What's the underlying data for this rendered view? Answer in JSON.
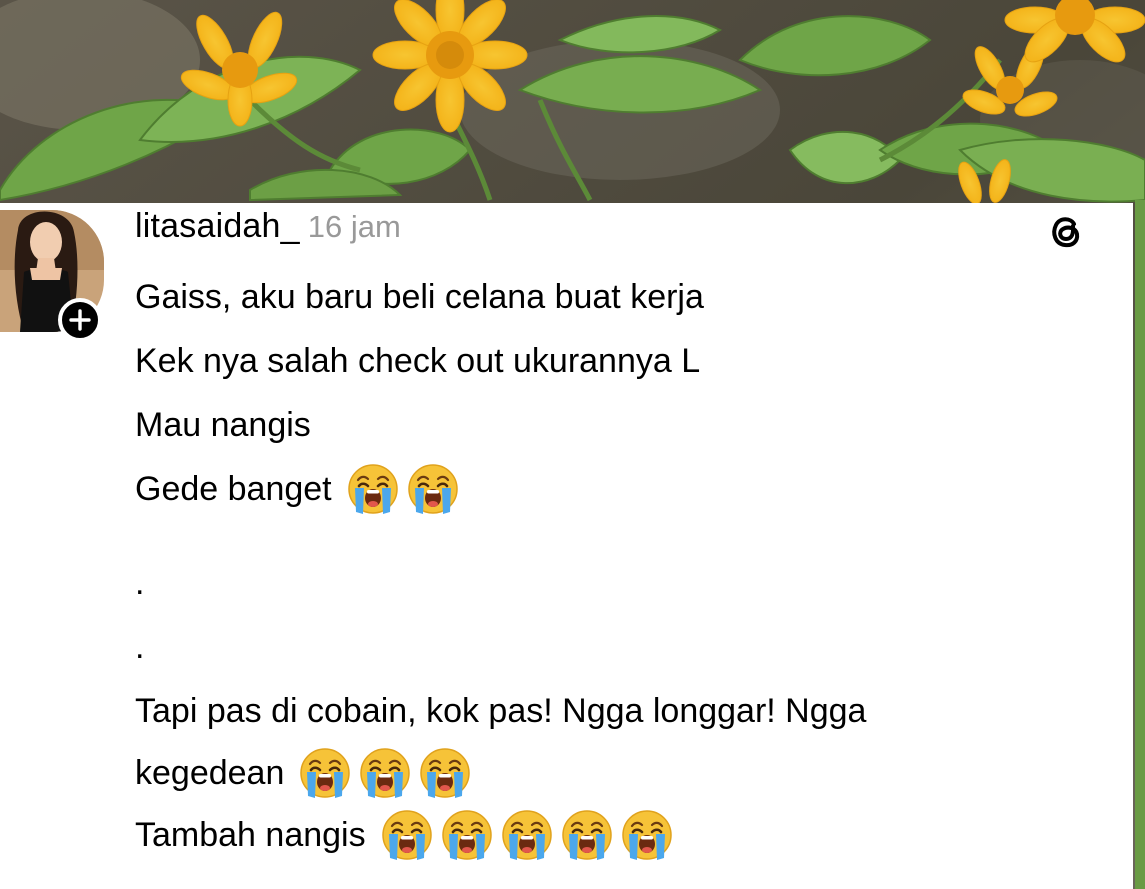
{
  "post": {
    "username": "litasaidah_",
    "timestamp": "16 jam",
    "lines": {
      "l1": "Gaiss, aku baru beli celana buat kerja",
      "l2": "Kek nya salah check out ukurannya L",
      "l3": "Mau nangis",
      "l4": "Gede banget",
      "l5": ".",
      "l6": ".",
      "l7": "Tapi pas di cobain, kok pas! Ngga longgar! Ngga",
      "l8": "kegedean",
      "l9": "Tambah nangis"
    },
    "emoji_counts": {
      "l4": 2,
      "l8": 3,
      "l9": 5
    }
  },
  "icons": {
    "follow": "plus-icon",
    "app_logo": "threads-logo-icon",
    "emoji": "loudly-crying-face-emoji"
  },
  "colors": {
    "username": "#000000",
    "timestamp": "#999999",
    "body_text": "#000000",
    "card_background": "#ffffff",
    "follow_badge": "#000000"
  }
}
